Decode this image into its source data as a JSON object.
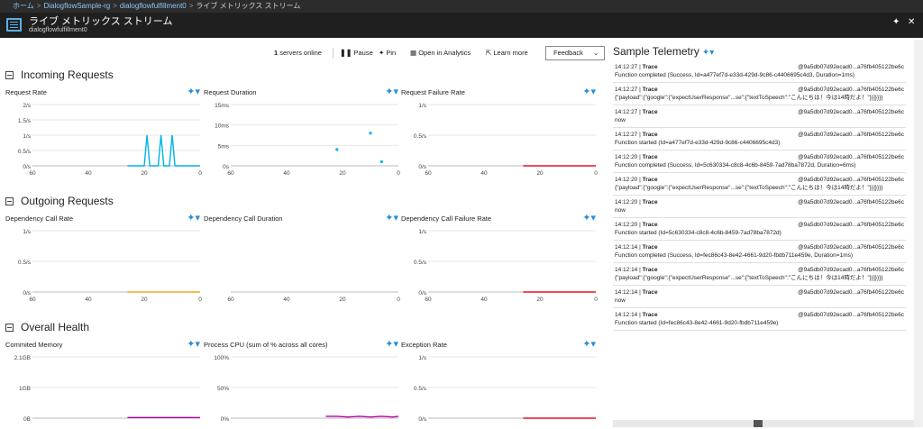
{
  "breadcrumb": {
    "home": "ホーム",
    "rg": "DialogflowSample-rg",
    "app": "dialogflowfulfillment0",
    "current": "ライブ メトリックス ストリーム",
    "separator": ">"
  },
  "blade": {
    "title": "ライブ メトリックス ストリーム",
    "subtitle": "dialogflowfulfillment0",
    "pin_icon": "pin-icon",
    "close_icon": "close-icon"
  },
  "toolbar": {
    "servers_count": "1",
    "servers_text": "servers online",
    "pause": "Pause",
    "pin": "Pin",
    "analytics": "Open in Analytics",
    "learn": "Learn more",
    "feedback": "Feedback"
  },
  "colors": {
    "accent": "#2a8fd0",
    "line_blue": "#00b4e6",
    "orange": "#f5a623",
    "red": "#e81123",
    "magenta": "#b4009e"
  },
  "sections": {
    "incoming": {
      "title": "Incoming Requests",
      "charts": [
        {
          "title": "Request Rate",
          "yticks": [
            "2/s",
            "1.5/s",
            "1/s",
            "0.5/s",
            "0/s"
          ],
          "xticks": [
            "60",
            "40",
            "20",
            "0"
          ]
        },
        {
          "title": "Request Duration",
          "yticks": [
            "15ms",
            "10ms",
            "5ms",
            "0s"
          ],
          "xticks": [
            "60",
            "40",
            "20",
            "0"
          ]
        },
        {
          "title": "Request Failure Rate",
          "yticks": [
            "1/s",
            "0.5/s",
            "0/s"
          ],
          "xticks": [
            "60",
            "40",
            "20",
            "0"
          ]
        }
      ]
    },
    "outgoing": {
      "title": "Outgoing Requests",
      "charts": [
        {
          "title": "Dependency Call Rate",
          "yticks": [
            "1/s",
            "0.5/s",
            "0/s"
          ],
          "xticks": [
            "60",
            "40",
            "20",
            "0"
          ]
        },
        {
          "title": "Dependency Call Duration",
          "yticks": [],
          "xticks": [
            "60",
            "40",
            "20",
            "0"
          ]
        },
        {
          "title": "Dependency Call Failure Rate",
          "yticks": [
            "1/s",
            "0.5/s",
            "0/s"
          ],
          "xticks": [
            "60",
            "40",
            "20",
            "0"
          ]
        }
      ]
    },
    "health": {
      "title": "Overall Health",
      "charts": [
        {
          "title": "Commited Memory",
          "yticks": [
            "2.1GB",
            "1GB",
            "0B"
          ],
          "xticks": []
        },
        {
          "title": "Process CPU (sum of % across all cores)",
          "yticks": [
            "100%",
            "50%",
            "0%"
          ],
          "xticks": []
        },
        {
          "title": "Exception Rate",
          "yticks": [
            "1/s",
            "0.5/s",
            "0/s"
          ],
          "xticks": []
        }
      ]
    }
  },
  "chart_data": [
    {
      "type": "line",
      "title": "Request Rate",
      "ylim": [
        0,
        2
      ],
      "xlim": [
        60,
        0
      ],
      "series": [
        {
          "x": [
            26,
            24,
            20,
            19,
            18,
            15,
            14,
            13,
            11,
            10,
            9,
            0
          ],
          "y": [
            0,
            0,
            0,
            1,
            0,
            0,
            1,
            0,
            0,
            1,
            0,
            0
          ]
        }
      ]
    },
    {
      "type": "scatter",
      "title": "Request Duration",
      "ylim": [
        0,
        15
      ],
      "xlim": [
        60,
        0
      ],
      "series": [
        {
          "x": [
            22,
            10,
            6
          ],
          "y": [
            4,
            8,
            1
          ]
        }
      ]
    },
    {
      "type": "line",
      "title": "Request Failure Rate",
      "ylim": [
        0,
        1
      ],
      "xlim": [
        60,
        0
      ],
      "series": [
        {
          "x": [
            26,
            0
          ],
          "y": [
            0,
            0
          ]
        }
      ]
    },
    {
      "type": "line",
      "title": "Dependency Call Rate",
      "ylim": [
        0,
        1
      ],
      "xlim": [
        60,
        0
      ],
      "series": [
        {
          "x": [
            26,
            0
          ],
          "y": [
            0,
            0
          ]
        }
      ]
    },
    {
      "type": "line",
      "title": "Dependency Call Failure Rate",
      "ylim": [
        0,
        1
      ],
      "xlim": [
        60,
        0
      ],
      "series": [
        {
          "x": [
            26,
            0
          ],
          "y": [
            0,
            0
          ]
        }
      ]
    },
    {
      "type": "line",
      "title": "Commited Memory",
      "ylim": [
        0,
        2.1
      ],
      "xlim": [
        60,
        0
      ],
      "series": [
        {
          "x": [
            26,
            0
          ],
          "y": [
            0.02,
            0.02
          ]
        }
      ]
    },
    {
      "type": "line",
      "title": "Process CPU (sum of % across all cores)",
      "ylim": [
        0,
        100
      ],
      "xlim": [
        60,
        0
      ],
      "series": [
        {
          "x": [
            26,
            22,
            18,
            14,
            10,
            6,
            2,
            0
          ],
          "y": [
            3,
            3,
            2,
            3,
            2,
            3,
            2,
            3
          ]
        }
      ]
    },
    {
      "type": "line",
      "title": "Exception Rate",
      "ylim": [
        0,
        1
      ],
      "xlim": [
        60,
        0
      ],
      "series": [
        {
          "x": [
            26,
            0
          ],
          "y": [
            0,
            0
          ]
        }
      ]
    }
  ],
  "telemetry": {
    "title": "Sample Telemetry",
    "rows": [
      {
        "time": "14:12:27",
        "type": "Trace",
        "id": "@9a5db07d92ecad0...a76fb405122be6c",
        "msg": "Function completed (Success, Id=a477ef7d-e33d-429d-9c86-c4406695c4d3, Duration=1ms)"
      },
      {
        "time": "14:12:27",
        "type": "Trace",
        "id": "@9a5db07d92ecad0...a76fb405122be6c",
        "msg": "{\"payload\":{\"google\":{\"expectUserResponse\"...se\":{\"textToSpeech\":\"こんにちは！今は14時だよ！\"}}]}}}}"
      },
      {
        "time": "14:12:27",
        "type": "Trace",
        "id": "@9a5db07d92ecad0...a76fb405122be6c",
        "msg": "now"
      },
      {
        "time": "14:12:27",
        "type": "Trace",
        "id": "@9a5db07d92ecad0...a76fb405122be6c",
        "msg": "Function started (Id=a477ef7d-e33d-429d-9c86-c4406695c4d3)"
      },
      {
        "time": "14:12:20",
        "type": "Trace",
        "id": "@9a5db07d92ecad0...a76fb405122be6c",
        "msg": "Function completed (Success, Id=5c630334-c8c8-4c6b-8459-7ad78ba7872d, Duration=6ms)"
      },
      {
        "time": "14:12:20",
        "type": "Trace",
        "id": "@9a5db07d92ecad0...a76fb405122be6c",
        "msg": "{\"payload\":{\"google\":{\"expectUserResponse\"...se\":{\"textToSpeech\":\"こんにちは！今は14時だよ！\"}}]}}}}"
      },
      {
        "time": "14:12:20",
        "type": "Trace",
        "id": "@9a5db07d92ecad0...a76fb405122be6c",
        "msg": "now"
      },
      {
        "time": "14:12:20",
        "type": "Trace",
        "id": "@9a5db07d92ecad0...a76fb405122be6c",
        "msg": "Function started (Id=5c630334-c8c8-4c6b-8459-7ad78ba7872d)"
      },
      {
        "time": "14:12:14",
        "type": "Trace",
        "id": "@9a5db07d92ecad0...a76fb405122be6c",
        "msg": "Function completed (Success, Id=fec86c43-8e42-4661-9d20-fbdb711e459e, Duration=1ms)"
      },
      {
        "time": "14:12:14",
        "type": "Trace",
        "id": "@9a5db07d92ecad0...a76fb405122be6c",
        "msg": "{\"payload\":{\"google\":{\"expectUserResponse\"...se\":{\"textToSpeech\":\"こんにちは！今は14時だよ！\"}}]}}}}"
      },
      {
        "time": "14:12:14",
        "type": "Trace",
        "id": "@9a5db07d92ecad0...a76fb405122be6c",
        "msg": "now"
      },
      {
        "time": "14:12:14",
        "type": "Trace",
        "id": "@9a5db07d92ecad0...a76fb405122be6c",
        "msg": "Function started (Id=fec86c43-8e42-4661-9d20-fbdb711e459e)"
      }
    ]
  }
}
